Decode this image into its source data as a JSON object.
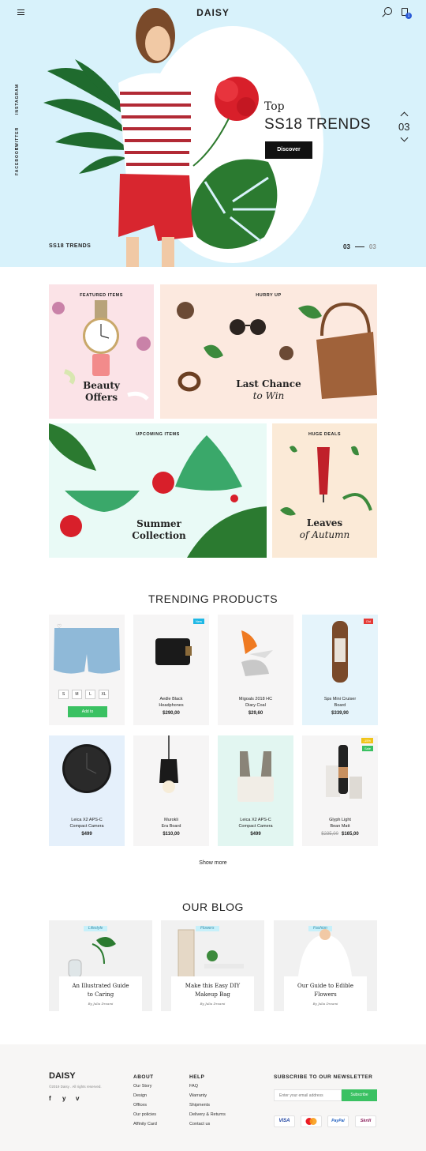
{
  "header": {
    "logo": "DAISY",
    "cart_count": "1"
  },
  "hero": {
    "social": [
      "INSTAGRAM",
      "TWITTER",
      "FACEBOOK"
    ],
    "eyebrow": "Top",
    "title": "SS18 TRENDS",
    "cta": "Discover",
    "slide_counter": "03",
    "bottom_label": "SS18 TRENDS",
    "pager_current": "03",
    "pager_total": "03"
  },
  "features": [
    {
      "caption": "FEATURED ITEMS",
      "title_1": "Beauty",
      "title_2": "Offers"
    },
    {
      "caption": "HURRY UP",
      "title_1": "Last Chance",
      "title_2": "to Win"
    },
    {
      "caption": "UPCOMING ITEMS",
      "title_1": "Summer",
      "title_2": "Collection"
    },
    {
      "caption": "HUGE DEALS",
      "title_1": "Leaves",
      "title_2": "of Autumn"
    }
  ],
  "trending": {
    "title": "TRENDING PRODUCTS",
    "sizes": [
      "S",
      "M",
      "L",
      "XL"
    ],
    "add_to_cart": "Add to",
    "products": [
      {
        "name_1": "",
        "name_2": "",
        "price": "",
        "old_price": "",
        "tag": ""
      },
      {
        "name_1": "Aedle Black",
        "name_2": "Headphones",
        "price": "$290,00",
        "old_price": "",
        "tag": "New"
      },
      {
        "name_1": "Migoals 2018 HC",
        "name_2": "Diary Coal",
        "price": "$29,60",
        "old_price": "",
        "tag": ""
      },
      {
        "name_1": "Sps Mini Cruiser",
        "name_2": "Board",
        "price": "$339,90",
        "old_price": "",
        "tag": "Old"
      },
      {
        "name_1": "Leica X2 APS-C",
        "name_2": "Compact Camera",
        "price": "$499",
        "old_price": "",
        "tag": ""
      },
      {
        "name_1": "Murokli",
        "name_2": "Era Board",
        "price": "$110,00",
        "old_price": "",
        "tag": ""
      },
      {
        "name_1": "Leica X2 APS-C",
        "name_2": "Compact Camera",
        "price": "$499",
        "old_price": "",
        "tag": ""
      },
      {
        "name_1": "Glyph Light",
        "name_2": "Bean Matt",
        "price": "$165,00",
        "old_price": "$235,00",
        "tag": "-15%",
        "tag2": "Sale"
      }
    ],
    "show_more": "Show more"
  },
  "blog": {
    "title": "OUR BLOG",
    "posts": [
      {
        "label": "Lifestyle",
        "title_1": "An Illustrated Guide",
        "title_2": "to Caring",
        "by": "By Julia Dreami"
      },
      {
        "label": "Flowers",
        "title_1": "Make this Easy DIY",
        "title_2": "Makeup Bag",
        "by": "By Julia Dreami"
      },
      {
        "label": "Fashion",
        "title_1": "Our Guide to Edible",
        "title_2": "Flowers",
        "by": "By Julia Dreami"
      }
    ]
  },
  "footer": {
    "logo": "DAISY",
    "copyright": "©2019 Daisy . All rights reserved.",
    "about_title": "ABOUT",
    "about": [
      "Our Story",
      "Design",
      "Offices",
      "Our policies",
      "Affinity Card"
    ],
    "help_title": "HELP",
    "help": [
      "FAQ",
      "Warranty",
      "Shipments",
      "Delivery & Returns",
      "Contact us"
    ],
    "newsletter_title": "SUBSCRIBE TO OUR NEWSLETTER",
    "newsletter_placeholder": "Enter your email address",
    "subscribe": "Subscribe",
    "payments": [
      "VISA",
      "",
      "PayPal",
      "Skrill"
    ]
  },
  "colors": {
    "hero_bg": "#d8f2fb",
    "accent_green": "#3ac162",
    "badge_blue": "#2a5bd7",
    "sale_red": "#e53935"
  }
}
